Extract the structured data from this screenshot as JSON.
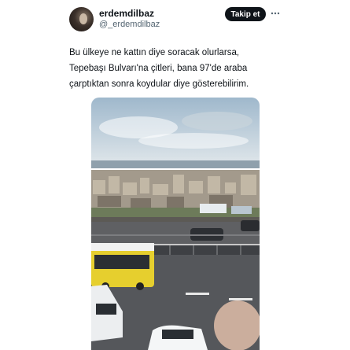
{
  "tweet": {
    "display_name": "erdemdilbaz",
    "handle": "@_erdemdilbaz",
    "follow_label": "Takip et",
    "text_lines": [
      "Bu ülkeye ne kattın diye soracak olurlarsa,",
      "Tepebaşı Bulvarı'na çitleri, bana 97'de araba",
      "çarptıktan sonra koydular diye gösterebilirim."
    ],
    "more_icon": "more-horizontal-icon",
    "media": {
      "kind": "photo",
      "description_icon": "city-road-photo"
    }
  },
  "colors": {
    "follow_bg": "#0f1419",
    "handle": "#536471",
    "bus_yellow": "#e6cf2e"
  }
}
